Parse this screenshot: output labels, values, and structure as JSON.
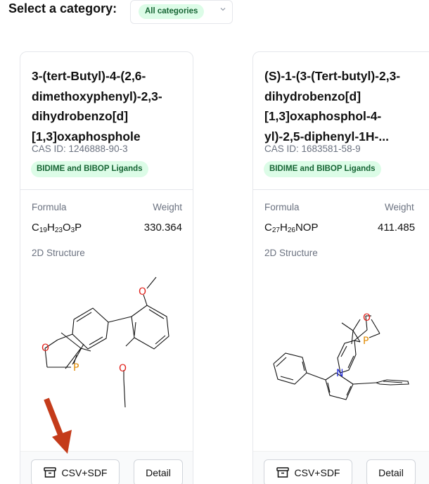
{
  "header": {
    "label": "Select a category:",
    "category_select": {
      "value": "All categories",
      "icon": "chevron-down-icon"
    }
  },
  "cards": [
    {
      "title": "3-(tert-Butyl)-4-(2,6-dimethoxyphenyl)-2,3-dihydrobenzo[d][1,3]oxaphosphole",
      "title_lines": [
        "3-(tert-Butyl)-4-(2,6-",
        "dimethoxyphenyl)-2,3-",
        "dihydrobenzo[d]",
        "[1,3]oxaphosphole"
      ],
      "cas": "CAS ID: 1246888-90-3",
      "category": "BIDIME and BIBOP Ligands",
      "formula_label": "Formula",
      "weight_label": "Weight",
      "formula": [
        "C",
        "19",
        "H",
        "23",
        "O",
        "3",
        "P"
      ],
      "weight": "330.364",
      "structure_label": "2D Structure",
      "atoms": [
        "O",
        "P",
        "O",
        "O"
      ],
      "csv_button": "CSV+SDF",
      "detail_button": "Detail"
    },
    {
      "title": "(S)-1-(3-(Tert-butyl)-2,3-dihydrobenzo[d][1,3]oxaphosphol-4-yl)-2,5-diphenyl-1H-...",
      "title_lines": [
        "(S)-1-(3-(Tert-butyl)-2,3-",
        "dihydrobenzo[d]",
        "[1,3]oxaphosphol-4-",
        "yl)-2,5-diphenyl-1H-..."
      ],
      "cas": "CAS ID: 1683581-58-9",
      "category": "BIDIME and BIBOP Ligands",
      "formula_label": "Formula",
      "weight_label": "Weight",
      "formula": [
        "C",
        "27",
        "H",
        "26",
        "NOP"
      ],
      "weight": "411.485",
      "structure_label": "2D Structure",
      "atoms": [
        "O",
        "P",
        "N"
      ],
      "csv_button": "CSV+SDF",
      "detail_button": "Detail"
    }
  ],
  "colors": {
    "accent_bg": "#dcfce7",
    "accent_text": "#166534",
    "oxygen": "#e0201a",
    "phosphorus": "#e08a00",
    "nitrogen": "#1f2ad6",
    "arrow": "#c43b1a"
  }
}
